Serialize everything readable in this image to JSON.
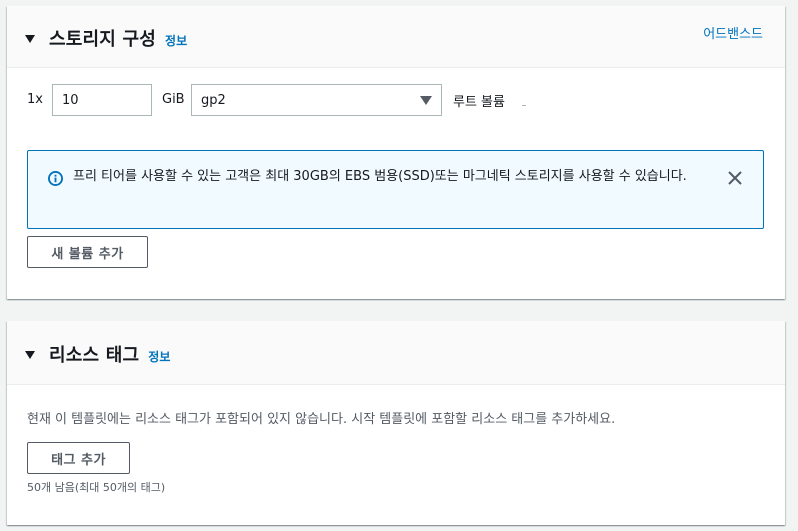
{
  "storage": {
    "title": "스토리지 구성",
    "info_link": "정보",
    "advanced_link": "어드밴스드",
    "count_label": "1x",
    "size_value": "10",
    "size_unit": "GiB",
    "volume_type": "gp2",
    "volume_label": "루트 볼륨",
    "alert_text": "프리 티어를 사용할 수 있는 고객은 최대 30GB의 EBS 범용(SSD)또는 마그네틱 스토리지를 사용할 수 있습니다.",
    "add_volume_label": "새 볼륨 추가"
  },
  "tags": {
    "title": "리소스 태그",
    "info_link": "정보",
    "description": "현재 이 템플릿에는 리소스 태그가 포함되어 있지 않습니다. 시작 템플릿에 포함할 리소스 태그를 추가하세요.",
    "add_tag_label": "태그 추가",
    "remaining": "50개 남음(최대 50개의 태그)"
  },
  "colors": {
    "link": "#0073bb",
    "alert_border": "#0073bb",
    "alert_background": "#f1faff"
  },
  "icons": {
    "collapse": "caret-down-icon",
    "info": "info-circle-icon",
    "close": "close-icon",
    "dropdown": "dropdown-caret-icon"
  }
}
